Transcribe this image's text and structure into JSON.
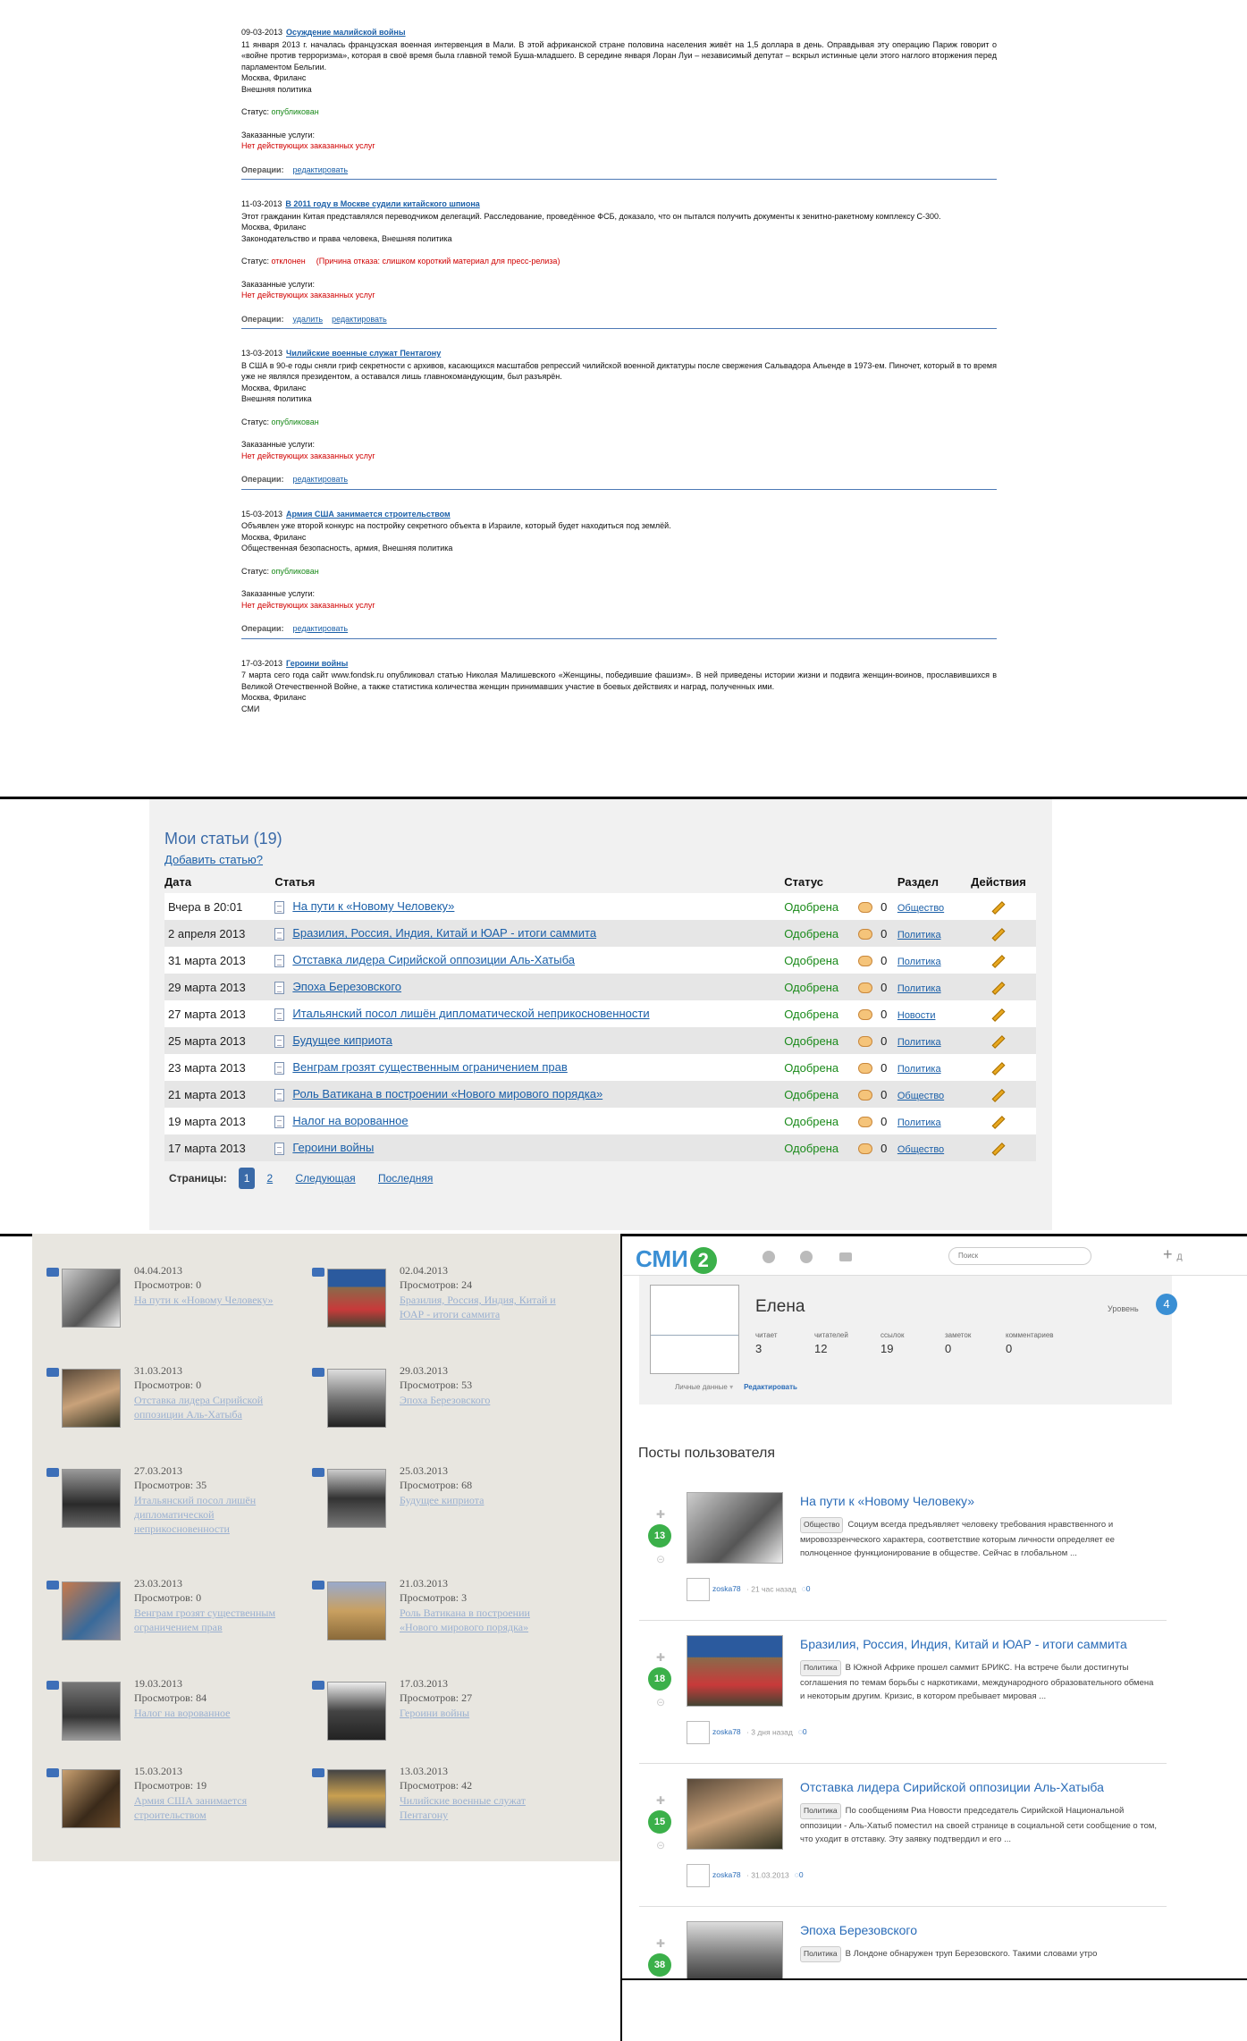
{
  "panel1": {
    "articles": [
      {
        "date": "09-03-2013",
        "title": "Осуждение малийской войны",
        "text": "11 января 2013 г. началась французская военная интервенция в Мали. В этой африканской стране половина населения живёт на 1,5 доллара в день. Оправдывая эту операцию Париж говорит о «войне против терроризма», которая в своё время была главной темой Буша-младшего. В середине января Лоран Луи – независимый депутат – вскрыл истинные цели этого наглого вторжения перед парламентом Бельгии.",
        "place": "Москва, Фриланс",
        "topics": "Внешняя политика",
        "status_label": "Статус:",
        "status": "опубликован",
        "status_kind": "ok",
        "reason": "",
        "ordered_label": "Заказанные услуги:",
        "ordered": "Нет действующих заказанных услуг",
        "oper_label": "Операции:",
        "ops": [
          "редактировать"
        ]
      },
      {
        "date": "11-03-2013",
        "title": "В 2011 году в Москве судили китайского шпиона",
        "text": "Этот гражданин Китая представлялся переводчиком делегаций. Расследование, проведённое ФСБ, доказало, что он пытался получить документы к зенитно-ракетному комплексу С-300.",
        "place": "Москва, Фриланс",
        "topics": "Законодательство и права человека, Внешняя политика",
        "status_label": "Статус:",
        "status": "отклонен",
        "status_kind": "bad",
        "reason": "(Причина отказа: слишком короткий материал для пресс-релиза)",
        "ordered_label": "Заказанные услуги:",
        "ordered": "Нет действующих заказанных услуг",
        "oper_label": "Операции:",
        "ops": [
          "удалить",
          "редактировать"
        ]
      },
      {
        "date": "13-03-2013",
        "title": "Чилийские военные служат Пентагону",
        "text": "В США в 90-е годы сняли гриф секретности с архивов, касающихся масштабов репрессий чилийской военной диктатуры после свержения Сальвадора Альенде в 1973-ем. Пиночет, который в то время уже не являлся президентом, а оставался лишь главнокомандующим, был разъярён.",
        "place": "Москва, Фриланс",
        "topics": "Внешняя политика",
        "status_label": "Статус:",
        "status": "опубликован",
        "status_kind": "ok",
        "reason": "",
        "ordered_label": "Заказанные услуги:",
        "ordered": "Нет действующих заказанных услуг",
        "oper_label": "Операции:",
        "ops": [
          "редактировать"
        ]
      },
      {
        "date": "15-03-2013",
        "title": "Армия США занимается строительством",
        "text": "Объявлен уже второй конкурс на постройку секретного объекта в Израиле, который будет находиться под землёй.",
        "place": "Москва, Фриланс",
        "topics": "Общественная безопасность, армия, Внешняя политика",
        "status_label": "Статус:",
        "status": "опубликован",
        "status_kind": "ok",
        "reason": "",
        "ordered_label": "Заказанные услуги:",
        "ordered": "Нет действующих заказанных услуг",
        "oper_label": "Операции:",
        "ops": [
          "редактировать"
        ]
      },
      {
        "date": "17-03-2013",
        "title": "Героини войны",
        "text": "7 марта сего года сайт www.fondsk.ru опубликовал статью Николая Малишевского «Женщины, победившие фашизм». В ней приведены истории жизни и подвига женщин-воинов, прославившихся в Великой Отечественной Войне, а также статистика количества женщин принимавших участие в боевых действиях и наград, полученных ими.",
        "place": "Москва, Фриланс",
        "topics": "СМИ",
        "status_label": "",
        "status": "",
        "status_kind": "ok",
        "reason": "",
        "ordered_label": "",
        "ordered": "",
        "oper_label": "",
        "ops": []
      }
    ]
  },
  "panel2": {
    "title": "Мои статьи (19)",
    "add_link": "Добавить статью?",
    "headers": [
      "Дата",
      "Статья",
      "Статус",
      "",
      "Раздел",
      "Действия"
    ],
    "rows": [
      {
        "date": "Вчера в 20:01",
        "title": "На пути к «Новому Человеку»",
        "status": "Одобрена",
        "comments": "0",
        "section": "Общество"
      },
      {
        "date": "2 апреля 2013",
        "title": "Бразилия, Россия, Индия, Китай и ЮАР - итоги саммита",
        "status": "Одобрена",
        "comments": "0",
        "section": "Политика"
      },
      {
        "date": "31 марта 2013",
        "title": "Отставка лидера Сирийской оппозиции Аль-Хатыба",
        "status": "Одобрена",
        "comments": "0",
        "section": "Политика"
      },
      {
        "date": "29 марта 2013",
        "title": "Эпоха Березовского",
        "status": "Одобрена",
        "comments": "0",
        "section": "Политика"
      },
      {
        "date": "27 марта 2013",
        "title": "Итальянский посол лишён дипломатической неприкосновенности",
        "status": "Одобрена",
        "comments": "0",
        "section": "Новости"
      },
      {
        "date": "25 марта 2013",
        "title": "Будущее киприота",
        "status": "Одобрена",
        "comments": "0",
        "section": "Политика"
      },
      {
        "date": "23 марта 2013",
        "title": "Венграм грозят существенным ограничением прав",
        "status": "Одобрена",
        "comments": "0",
        "section": "Политика"
      },
      {
        "date": "21 марта 2013",
        "title": "Роль Ватикана в построении «Нового мирового порядка»",
        "status": "Одобрена",
        "comments": "0",
        "section": "Общество"
      },
      {
        "date": "19 марта 2013",
        "title": "Налог на ворованное",
        "status": "Одобрена",
        "comments": "0",
        "section": "Политика"
      },
      {
        "date": "17 марта 2013",
        "title": "Героини войны",
        "status": "Одобрена",
        "comments": "0",
        "section": "Общество"
      }
    ],
    "pager": {
      "label": "Страницы:",
      "current": "1",
      "next_page": "2",
      "next": "Следующая",
      "last": "Последняя"
    }
  },
  "panel3": {
    "tiles": [
      {
        "date": "04.04.2013",
        "views": "Просмотров: 0",
        "title": "На пути к «Новому Человеку»"
      },
      {
        "date": "02.04.2013",
        "views": "Просмотров: 24",
        "title": "Бразилия, Россия, Индия, Китай и ЮАР - итоги саммита"
      },
      {
        "date": "31.03.2013",
        "views": "Просмотров: 0",
        "title": "Отставка лидера Сирийской оппозиции Аль-Хатыба"
      },
      {
        "date": "29.03.2013",
        "views": "Просмотров: 53",
        "title": "Эпоха Березовского"
      },
      {
        "date": "27.03.2013",
        "views": "Просмотров: 35",
        "title": "Итальянский посол лишён дипломатической неприкосновенности"
      },
      {
        "date": "25.03.2013",
        "views": "Просмотров: 68",
        "title": "Будущее киприота"
      },
      {
        "date": "23.03.2013",
        "views": "Просмотров: 0",
        "title": "Венграм грозят существенным ограничением прав"
      },
      {
        "date": "21.03.2013",
        "views": "Просмотров: 3",
        "title": "Роль Ватикана в построении «Нового мирового порядка»"
      },
      {
        "date": "19.03.2013",
        "views": "Просмотров: 84",
        "title": "Налог на ворованное"
      },
      {
        "date": "17.03.2013",
        "views": "Просмотров: 27",
        "title": "Героини войны"
      },
      {
        "date": "15.03.2013",
        "views": "Просмотров: 19",
        "title": "Армия США занимается строительством"
      },
      {
        "date": "13.03.2013",
        "views": "Просмотров: 42",
        "title": "Чилийские военные служат Пентагону"
      }
    ]
  },
  "panel4": {
    "logo_text": "СМИ",
    "logo_num": "2",
    "search_placeholder": "Поиск",
    "plus": "+",
    "plus_suffix": "Д",
    "name": "Елена",
    "level_label": "Уровень",
    "level": "4",
    "stats": [
      {
        "label": "читает",
        "value": "3"
      },
      {
        "label": "читателей",
        "value": "12"
      },
      {
        "label": "ссылок",
        "value": "19"
      },
      {
        "label": "заметок",
        "value": "0"
      },
      {
        "label": "комментариев",
        "value": "0"
      }
    ],
    "personal": "Личные данные",
    "edit": "Редактировать",
    "posts_title": "Посты пользователя",
    "posts": [
      {
        "score": "13",
        "title": "На пути к «Новому Человеку»",
        "tag": "Общество",
        "excerpt": "Социум всегда предъявляет человеку требования нравственного и мировоззренческого характера, соответствие которым личности определяет ее полноценное функционирование в обществе. Сейчас в глобальном ...",
        "user": "zoska78",
        "time": "21 час назад",
        "comments": "0"
      },
      {
        "score": "18",
        "title": "Бразилия, Россия, Индия, Китай и ЮАР - итоги саммита",
        "tag": "Политика",
        "excerpt": "В Южной Африке прошел саммит БРИКС. На встрече были достигнуты соглашения по темам борьбы с наркотиками, международного образовательного обмена и некоторым другим. Кризис, в котором пребывает мировая ...",
        "user": "zoska78",
        "time": "3 дня назад",
        "comments": "0"
      },
      {
        "score": "15",
        "title": "Отставка лидера Сирийской оппозиции Аль-Хатыба",
        "tag": "Политика",
        "excerpt": "По сообщениям Риа Новости председатель Сирийской Национальной оппозиции - Аль-Хатыб поместил на своей странице в социальной сети сообщение о том, что уходит в отставку. Эту заявку подтвердил и его ...",
        "user": "zoska78",
        "time": "31.03.2013",
        "comments": "0"
      },
      {
        "score": "38",
        "title": "Эпоха Березовского",
        "tag": "Политика",
        "excerpt": "В Лондоне обнаружен труп Березовского. Такими словами утро",
        "user": "",
        "time": "",
        "comments": ""
      }
    ]
  }
}
